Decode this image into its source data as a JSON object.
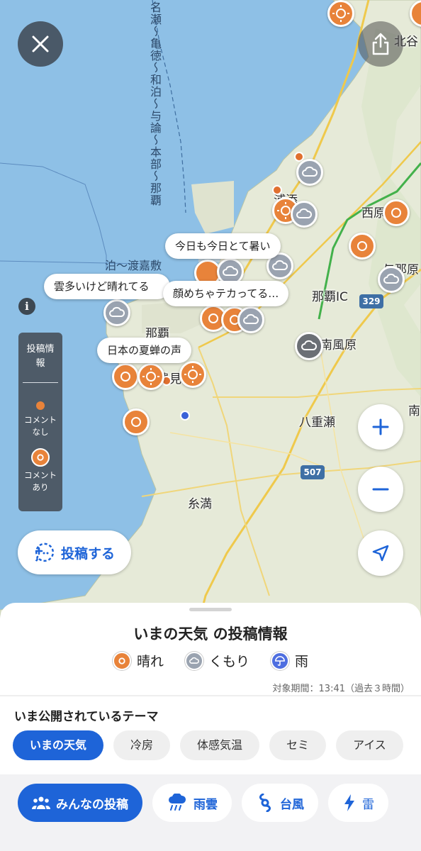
{
  "map": {
    "places": {
      "kitaya": "北谷",
      "urasoe": "浦添",
      "nishihara": "西原",
      "yonabaru": "与那原",
      "naha": "那覇",
      "naha_ic": "那覇IC",
      "haebaru": "南風原",
      "tomigusuku": "豊見城",
      "yaese": "八重瀬",
      "itoman": "糸満",
      "nanjo": "南"
    },
    "route_vertical": "名瀬〜亀徳〜和泊〜与論〜本部〜那覇",
    "route_horizontal": "泊〜渡嘉敷",
    "highways": [
      "329",
      "507"
    ],
    "comments": [
      "今日も今日とて暑い",
      "雲多いけど晴れてる",
      "顔めちゃテカってる…",
      "日本の夏蝉の声"
    ]
  },
  "legend": {
    "title": "投稿情報",
    "no_comment": "コメントなし",
    "with_comment": "コメントあり"
  },
  "post_button": "投稿する",
  "sheet": {
    "title": "いまの天気 の投稿情報",
    "weather": [
      "晴れ",
      "くもり",
      "雨"
    ],
    "period": "対象期間：13:41（過去３時間）",
    "themes_title": "いま公開されているテーマ",
    "themes": [
      "いまの天気",
      "冷房",
      "体感気温",
      "セミ",
      "アイス"
    ],
    "tabs": [
      "みんなの投稿",
      "雨雲",
      "台風",
      "雷"
    ]
  },
  "colors": {
    "accent": "#1e64d8",
    "sun": "#e8833a",
    "cloud": "#9aa3b0",
    "sea": "#8ec0e6",
    "land": "#e6ead8"
  }
}
